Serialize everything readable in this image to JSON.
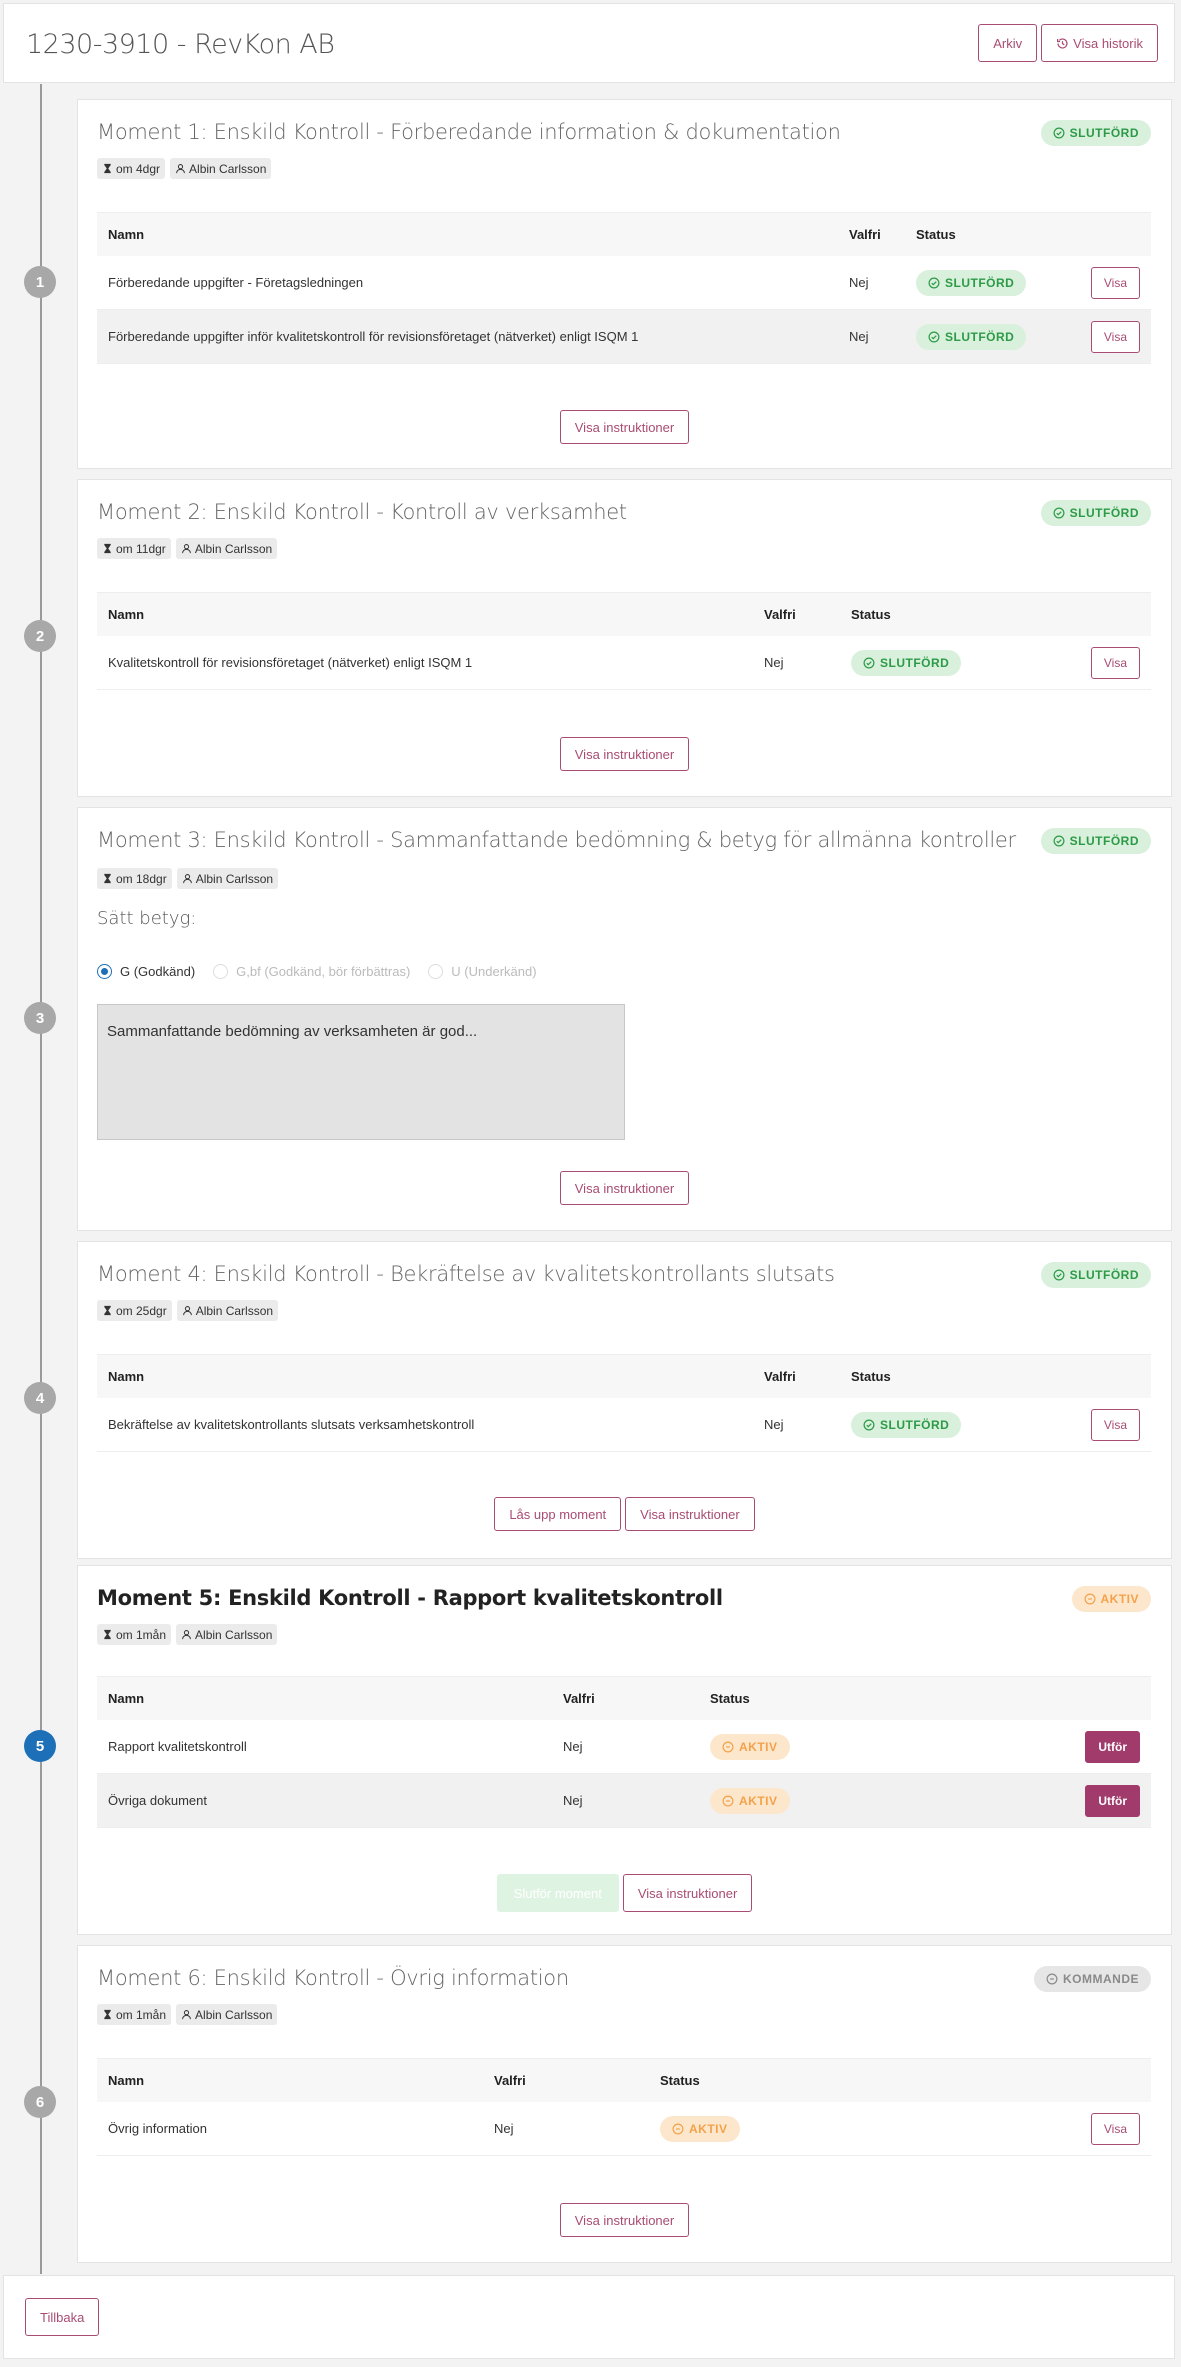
{
  "header": {
    "title": "1230-3910 - RevKon AB",
    "archive_label": "Arkiv",
    "history_label": "Visa historik"
  },
  "table_headers": {
    "name": "Namn",
    "optional": "Valfri",
    "status": "Status"
  },
  "labels": {
    "view": "Visa",
    "instructions": "Visa instruktioner",
    "unlock": "Lås upp moment",
    "finish": "Slutför moment",
    "execute": "Utför",
    "back": "Tillbaka"
  },
  "status": {
    "done": "SLUTFÖRD",
    "active": "AKTIV",
    "upcoming": "KOMMANDE"
  },
  "colors": {
    "accent": "#a94c73",
    "done": "#2d9a47",
    "active": "#f3a24a",
    "upcoming": "#8a8a8a",
    "timeline_active": "#1d6fb8"
  },
  "moments": [
    {
      "number": "1",
      "title": "Moment 1: Enskild Kontroll - Förberedande information & dokumentation",
      "due": "om 4dgr",
      "assignee": "Albin Carlsson",
      "rows": [
        {
          "name": "Förberedande uppgifter - Företagsledningen",
          "optional": "Nej"
        },
        {
          "name": "Förberedande uppgifter inför kvalitetskontroll för revisionsföretaget (nätverket) enligt ISQM 1",
          "optional": "Nej"
        }
      ]
    },
    {
      "number": "2",
      "title": "Moment 2: Enskild Kontroll - Kontroll av verksamhet",
      "due": "om 11dgr",
      "assignee": "Albin Carlsson",
      "rows": [
        {
          "name": "Kvalitetskontroll för revisionsföretaget (nätverket) enligt ISQM 1",
          "optional": "Nej"
        }
      ]
    },
    {
      "number": "3",
      "title": "Moment 3: Enskild Kontroll - Sammanfattande bedömning & betyg för allmänna kontroller",
      "due": "om 18dgr",
      "assignee": "Albin Carlsson",
      "grade_label": "Sätt betyg:",
      "grades": [
        "G (Godkänd)",
        "G,bf (Godkänd, bör förbättras)",
        "U (Underkänd)"
      ],
      "assessment": "Sammanfattande bedömning av verksamheten är god..."
    },
    {
      "number": "4",
      "title": "Moment 4: Enskild Kontroll - Bekräftelse av kvalitetskontrollants slutsats",
      "due": "om 25dgr",
      "assignee": "Albin Carlsson",
      "rows": [
        {
          "name": "Bekräftelse av kvalitetskontrollants slutsats verksamhetskontroll",
          "optional": "Nej"
        }
      ]
    },
    {
      "number": "5",
      "title": "Moment 5: Enskild Kontroll - Rapport kvalitetskontroll",
      "due": "om 1mån",
      "assignee": "Albin Carlsson",
      "rows": [
        {
          "name": "Rapport kvalitetskontroll",
          "optional": "Nej"
        },
        {
          "name": "Övriga dokument",
          "optional": "Nej"
        }
      ]
    },
    {
      "number": "6",
      "title": "Moment 6: Enskild Kontroll - Övrig information",
      "due": "om 1mån",
      "assignee": "Albin Carlsson",
      "rows": [
        {
          "name": "Övrig information",
          "optional": "Nej"
        }
      ]
    }
  ]
}
